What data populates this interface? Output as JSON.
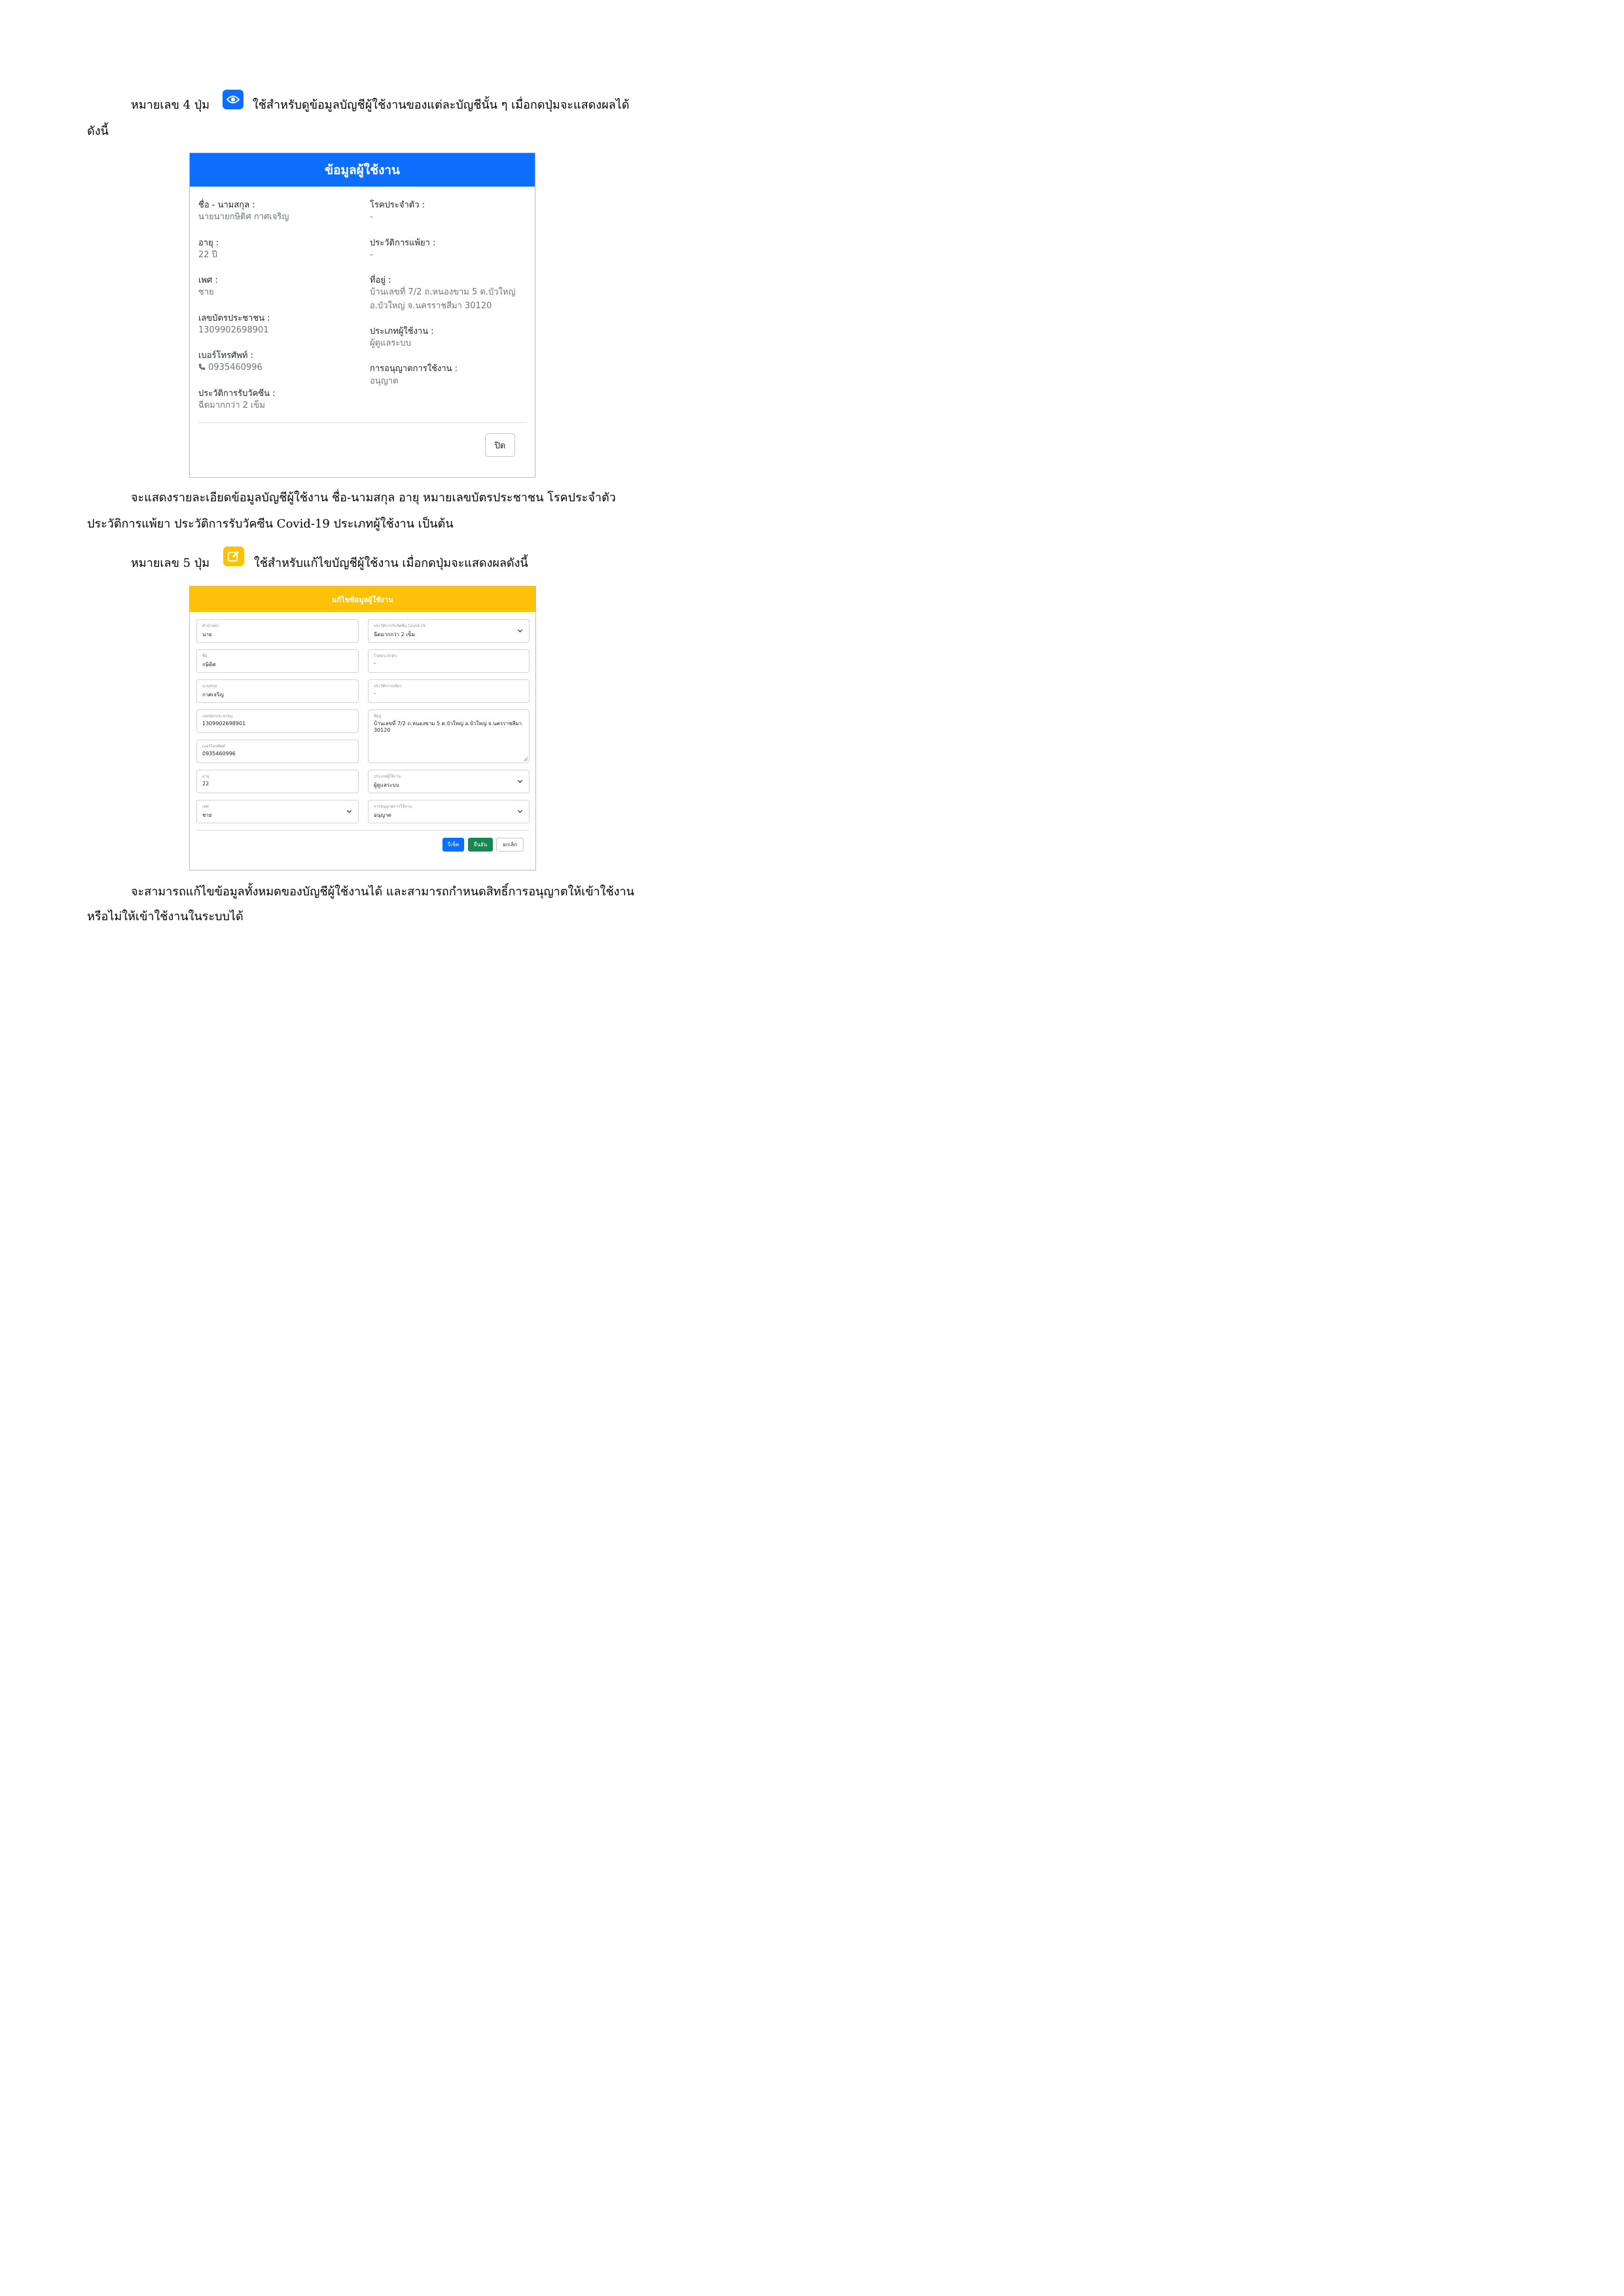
{
  "intro4": {
    "number": "หมายเลข 4 ปุ่ม",
    "desc": "ใช้สำหรับดูข้อมูลบัญชีผู้ใช้งานของแต่ละบัญชีนั้น ๆ เมื่อกดปุ่มจะแสดงผลได้",
    "cont": "ดังนี้"
  },
  "view_modal": {
    "title": "ข้อมูลผู้ใช้งาน",
    "left": [
      {
        "label": "ชื่อ - นามสกุล :",
        "value": "นายนายกษิดิศ กาศเจริญ"
      },
      {
        "label": "อายุ :",
        "value": "22 ปี"
      },
      {
        "label": "เพศ :",
        "value": "ชาย"
      },
      {
        "label": "เลขบัตรประชาชน :",
        "value": "1309902698901"
      },
      {
        "label": "เบอร์โทรศัพท์ :",
        "value": "0935460996"
      },
      {
        "label": "ประวัติการรับวัคซีน :",
        "value": "ฉีดมากกว่า 2 เข็ม"
      }
    ],
    "right": [
      {
        "label": "โรคประจำตัว :",
        "value": "-"
      },
      {
        "label": "ประวัติการแพ้ยา :",
        "value": "-"
      },
      {
        "label": "ที่อยู่ :",
        "value": "บ้านเลขที่ 7/2 ถ.หนองขาม 5 ต.บัวใหญ่",
        "value2": "อ.บัวใหญ่ จ.นครราชสีมา 30120"
      },
      {
        "label": "ประเภทผู้ใช้งาน :",
        "value": "ผู้ดูแลระบบ"
      },
      {
        "label": "การอนุญาตการใช้งาน :",
        "value": "อนุญาต"
      }
    ],
    "close": "ปิด"
  },
  "para1": {
    "line1": "จะแสดงรายละเอียดข้อมูลบัญชีผู้ใช้งาน  ชื่อ-นามสกุล อายุ หมายเลขบัตรประชาชน  โรคประจำตัว",
    "line2": "ประวัติการแพ้ยา ประวัติการรับวัคซีน Covid-19  ประเภทผู้ใช้งาน เป็นต้น"
  },
  "intro5": {
    "number": "หมายเลข 5 ปุ่ม",
    "desc": "ใช้สำหรับแก้ไขบัญชีผู้ใช้งาน เมื่อกดปุ่มจะแสดงผลดังนี้"
  },
  "edit_modal": {
    "title": "แก้ไขข้อมูลผู้ใช้งาน",
    "prefix": {
      "label": "คำนำหน้า",
      "value": "นาย"
    },
    "first": {
      "label": "ชื่อ",
      "value": "กษิดิศ"
    },
    "last": {
      "label": "นามสกุล",
      "value": "กาศเจริญ"
    },
    "idcard": {
      "label": "เลขบัตรประชาชน",
      "value": "1309902698901"
    },
    "phone": {
      "label": "เบอร์โทรศัพท์",
      "value": "0935460996"
    },
    "age": {
      "label": "อายุ",
      "value": "22"
    },
    "gender": {
      "label": "เพศ",
      "value": "ชาย"
    },
    "vaccine": {
      "label": "ประวัติการรับวัคซีน Covid-19",
      "value": "ฉีดมากกว่า 2 เข็ม"
    },
    "disease": {
      "label": "โรคประจำตัว",
      "value": "-"
    },
    "allergy": {
      "label": "ประวัติการแพ้ยา",
      "value": "-"
    },
    "address": {
      "label": "ที่อยู่",
      "value": "บ้านเลขที่ 7/2 ถ.หนองขาม 5 ต.บัวใหญ่ อ.บัวใหญ่ จ.นครราชสีมา 30120"
    },
    "usertype": {
      "label": "ประเภทผู้ใช้งาน",
      "value": "ผู้ดูแลระบบ"
    },
    "permission": {
      "label": "การอนุญาตการใช้งาน",
      "value": "อนุญาต"
    },
    "reset": "รีเซ็ต",
    "confirm": "ยืนยัน",
    "cancel": "ยกเลิก"
  },
  "para2": {
    "line1": "จะสามารถแก้ไขข้อมูลทั้งหมดของบัญชีผู้ใช้งานได้ และสามารถกำหนดสิทธิ์การอนุญาตให้เข้าใช้งาน",
    "line2": "หรือไม่ให้เข้าใช้งานในระบบได้"
  },
  "colors": {
    "view_header": "#0d6efd",
    "edit_header": "#ffc107",
    "reset": "#0d6efd",
    "confirm": "#198754"
  }
}
